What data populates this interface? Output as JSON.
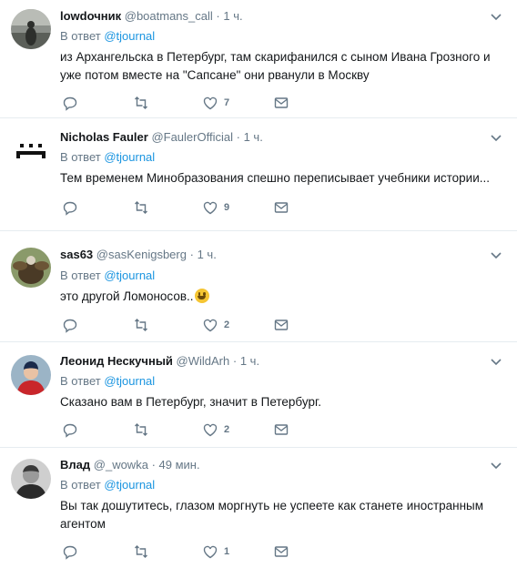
{
  "colors": {
    "accent": "#1b95e0",
    "secondary_text": "#657786",
    "divider": "#e6ecf0"
  },
  "tweets": [
    {
      "name": "lowdочник",
      "handle": "@boatmans_call",
      "dot": "·",
      "time": "1 ч.",
      "reply_prefix": "В ответ",
      "reply_to": "@tjournal",
      "text": "из Архангельска в Петербург, там скарифанился с сыном Ивана Грозного и уже потом вместе на \"Сапсане\" они рванули в Москву",
      "likes": "7",
      "avatar_icon": "photo-silhouette"
    },
    {
      "name": "Nicholas Fauler",
      "handle": "@FaulerOfficial",
      "dot": "·",
      "time": "1 ч.",
      "reply_prefix": "В ответ",
      "reply_to": "@tjournal",
      "text": "Тем временем Минобразования спешно переписывает учебники истории...",
      "likes": "9",
      "avatar_icon": "pixel-space-invader"
    },
    {
      "name": "sas63",
      "handle": "@sasKenigsberg",
      "dot": "·",
      "time": "1 ч.",
      "reply_prefix": "В ответ",
      "reply_to": "@tjournal",
      "text": "это другой Ломоносов..",
      "emoji": "grinning-face-emoji",
      "likes": "2",
      "avatar_icon": "eagle-photo"
    },
    {
      "name": "Леонид Нескучный",
      "handle": "@WildArh",
      "dot": "·",
      "time": "1 ч.",
      "reply_prefix": "В ответ",
      "reply_to": "@tjournal",
      "text": "Сказано вам в Петербург, значит в Петербург.",
      "likes": "2",
      "avatar_icon": "person-red-jacket"
    },
    {
      "name": "Влад",
      "handle": "@_wowka",
      "dot": "·",
      "time": "49 мин.",
      "reply_prefix": "В ответ",
      "reply_to": "@tjournal",
      "text": "Вы так дошутитесь, глазом моргнуть не успеете как станете иностранным агентом",
      "likes": "1",
      "avatar_icon": "person-bw-photo"
    }
  ]
}
